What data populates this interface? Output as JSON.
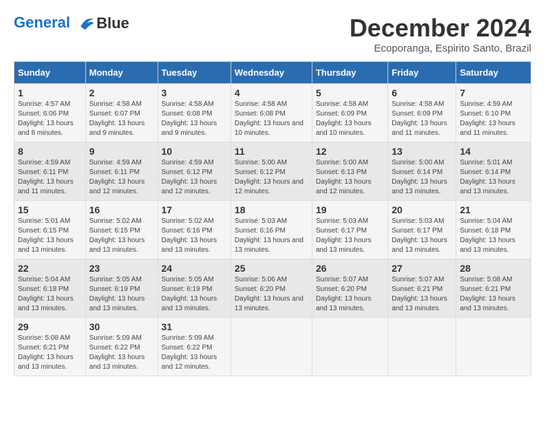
{
  "logo": {
    "line1": "General",
    "line2": "Blue"
  },
  "title": "December 2024",
  "location": "Ecoporanga, Espirito Santo, Brazil",
  "weekdays": [
    "Sunday",
    "Monday",
    "Tuesday",
    "Wednesday",
    "Thursday",
    "Friday",
    "Saturday"
  ],
  "weeks": [
    [
      {
        "day": "1",
        "sunrise": "Sunrise: 4:57 AM",
        "sunset": "Sunset: 6:06 PM",
        "daylight": "Daylight: 13 hours and 8 minutes."
      },
      {
        "day": "2",
        "sunrise": "Sunrise: 4:58 AM",
        "sunset": "Sunset: 6:07 PM",
        "daylight": "Daylight: 13 hours and 9 minutes."
      },
      {
        "day": "3",
        "sunrise": "Sunrise: 4:58 AM",
        "sunset": "Sunset: 6:08 PM",
        "daylight": "Daylight: 13 hours and 9 minutes."
      },
      {
        "day": "4",
        "sunrise": "Sunrise: 4:58 AM",
        "sunset": "Sunset: 6:08 PM",
        "daylight": "Daylight: 13 hours and 10 minutes."
      },
      {
        "day": "5",
        "sunrise": "Sunrise: 4:58 AM",
        "sunset": "Sunset: 6:09 PM",
        "daylight": "Daylight: 13 hours and 10 minutes."
      },
      {
        "day": "6",
        "sunrise": "Sunrise: 4:58 AM",
        "sunset": "Sunset: 6:09 PM",
        "daylight": "Daylight: 13 hours and 11 minutes."
      },
      {
        "day": "7",
        "sunrise": "Sunrise: 4:59 AM",
        "sunset": "Sunset: 6:10 PM",
        "daylight": "Daylight: 13 hours and 11 minutes."
      }
    ],
    [
      {
        "day": "8",
        "sunrise": "Sunrise: 4:59 AM",
        "sunset": "Sunset: 6:11 PM",
        "daylight": "Daylight: 13 hours and 11 minutes."
      },
      {
        "day": "9",
        "sunrise": "Sunrise: 4:59 AM",
        "sunset": "Sunset: 6:11 PM",
        "daylight": "Daylight: 13 hours and 12 minutes."
      },
      {
        "day": "10",
        "sunrise": "Sunrise: 4:59 AM",
        "sunset": "Sunset: 6:12 PM",
        "daylight": "Daylight: 13 hours and 12 minutes."
      },
      {
        "day": "11",
        "sunrise": "Sunrise: 5:00 AM",
        "sunset": "Sunset: 6:12 PM",
        "daylight": "Daylight: 13 hours and 12 minutes."
      },
      {
        "day": "12",
        "sunrise": "Sunrise: 5:00 AM",
        "sunset": "Sunset: 6:13 PM",
        "daylight": "Daylight: 13 hours and 12 minutes."
      },
      {
        "day": "13",
        "sunrise": "Sunrise: 5:00 AM",
        "sunset": "Sunset: 6:14 PM",
        "daylight": "Daylight: 13 hours and 13 minutes."
      },
      {
        "day": "14",
        "sunrise": "Sunrise: 5:01 AM",
        "sunset": "Sunset: 6:14 PM",
        "daylight": "Daylight: 13 hours and 13 minutes."
      }
    ],
    [
      {
        "day": "15",
        "sunrise": "Sunrise: 5:01 AM",
        "sunset": "Sunset: 6:15 PM",
        "daylight": "Daylight: 13 hours and 13 minutes."
      },
      {
        "day": "16",
        "sunrise": "Sunrise: 5:02 AM",
        "sunset": "Sunset: 6:15 PM",
        "daylight": "Daylight: 13 hours and 13 minutes."
      },
      {
        "day": "17",
        "sunrise": "Sunrise: 5:02 AM",
        "sunset": "Sunset: 6:16 PM",
        "daylight": "Daylight: 13 hours and 13 minutes."
      },
      {
        "day": "18",
        "sunrise": "Sunrise: 5:03 AM",
        "sunset": "Sunset: 6:16 PM",
        "daylight": "Daylight: 13 hours and 13 minutes."
      },
      {
        "day": "19",
        "sunrise": "Sunrise: 5:03 AM",
        "sunset": "Sunset: 6:17 PM",
        "daylight": "Daylight: 13 hours and 13 minutes."
      },
      {
        "day": "20",
        "sunrise": "Sunrise: 5:03 AM",
        "sunset": "Sunset: 6:17 PM",
        "daylight": "Daylight: 13 hours and 13 minutes."
      },
      {
        "day": "21",
        "sunrise": "Sunrise: 5:04 AM",
        "sunset": "Sunset: 6:18 PM",
        "daylight": "Daylight: 13 hours and 13 minutes."
      }
    ],
    [
      {
        "day": "22",
        "sunrise": "Sunrise: 5:04 AM",
        "sunset": "Sunset: 6:18 PM",
        "daylight": "Daylight: 13 hours and 13 minutes."
      },
      {
        "day": "23",
        "sunrise": "Sunrise: 5:05 AM",
        "sunset": "Sunset: 6:19 PM",
        "daylight": "Daylight: 13 hours and 13 minutes."
      },
      {
        "day": "24",
        "sunrise": "Sunrise: 5:05 AM",
        "sunset": "Sunset: 6:19 PM",
        "daylight": "Daylight: 13 hours and 13 minutes."
      },
      {
        "day": "25",
        "sunrise": "Sunrise: 5:06 AM",
        "sunset": "Sunset: 6:20 PM",
        "daylight": "Daylight: 13 hours and 13 minutes."
      },
      {
        "day": "26",
        "sunrise": "Sunrise: 5:07 AM",
        "sunset": "Sunset: 6:20 PM",
        "daylight": "Daylight: 13 hours and 13 minutes."
      },
      {
        "day": "27",
        "sunrise": "Sunrise: 5:07 AM",
        "sunset": "Sunset: 6:21 PM",
        "daylight": "Daylight: 13 hours and 13 minutes."
      },
      {
        "day": "28",
        "sunrise": "Sunrise: 5:08 AM",
        "sunset": "Sunset: 6:21 PM",
        "daylight": "Daylight: 13 hours and 13 minutes."
      }
    ],
    [
      {
        "day": "29",
        "sunrise": "Sunrise: 5:08 AM",
        "sunset": "Sunset: 6:21 PM",
        "daylight": "Daylight: 13 hours and 13 minutes."
      },
      {
        "day": "30",
        "sunrise": "Sunrise: 5:09 AM",
        "sunset": "Sunset: 6:22 PM",
        "daylight": "Daylight: 13 hours and 13 minutes."
      },
      {
        "day": "31",
        "sunrise": "Sunrise: 5:09 AM",
        "sunset": "Sunset: 6:22 PM",
        "daylight": "Daylight: 13 hours and 12 minutes."
      },
      null,
      null,
      null,
      null
    ]
  ]
}
